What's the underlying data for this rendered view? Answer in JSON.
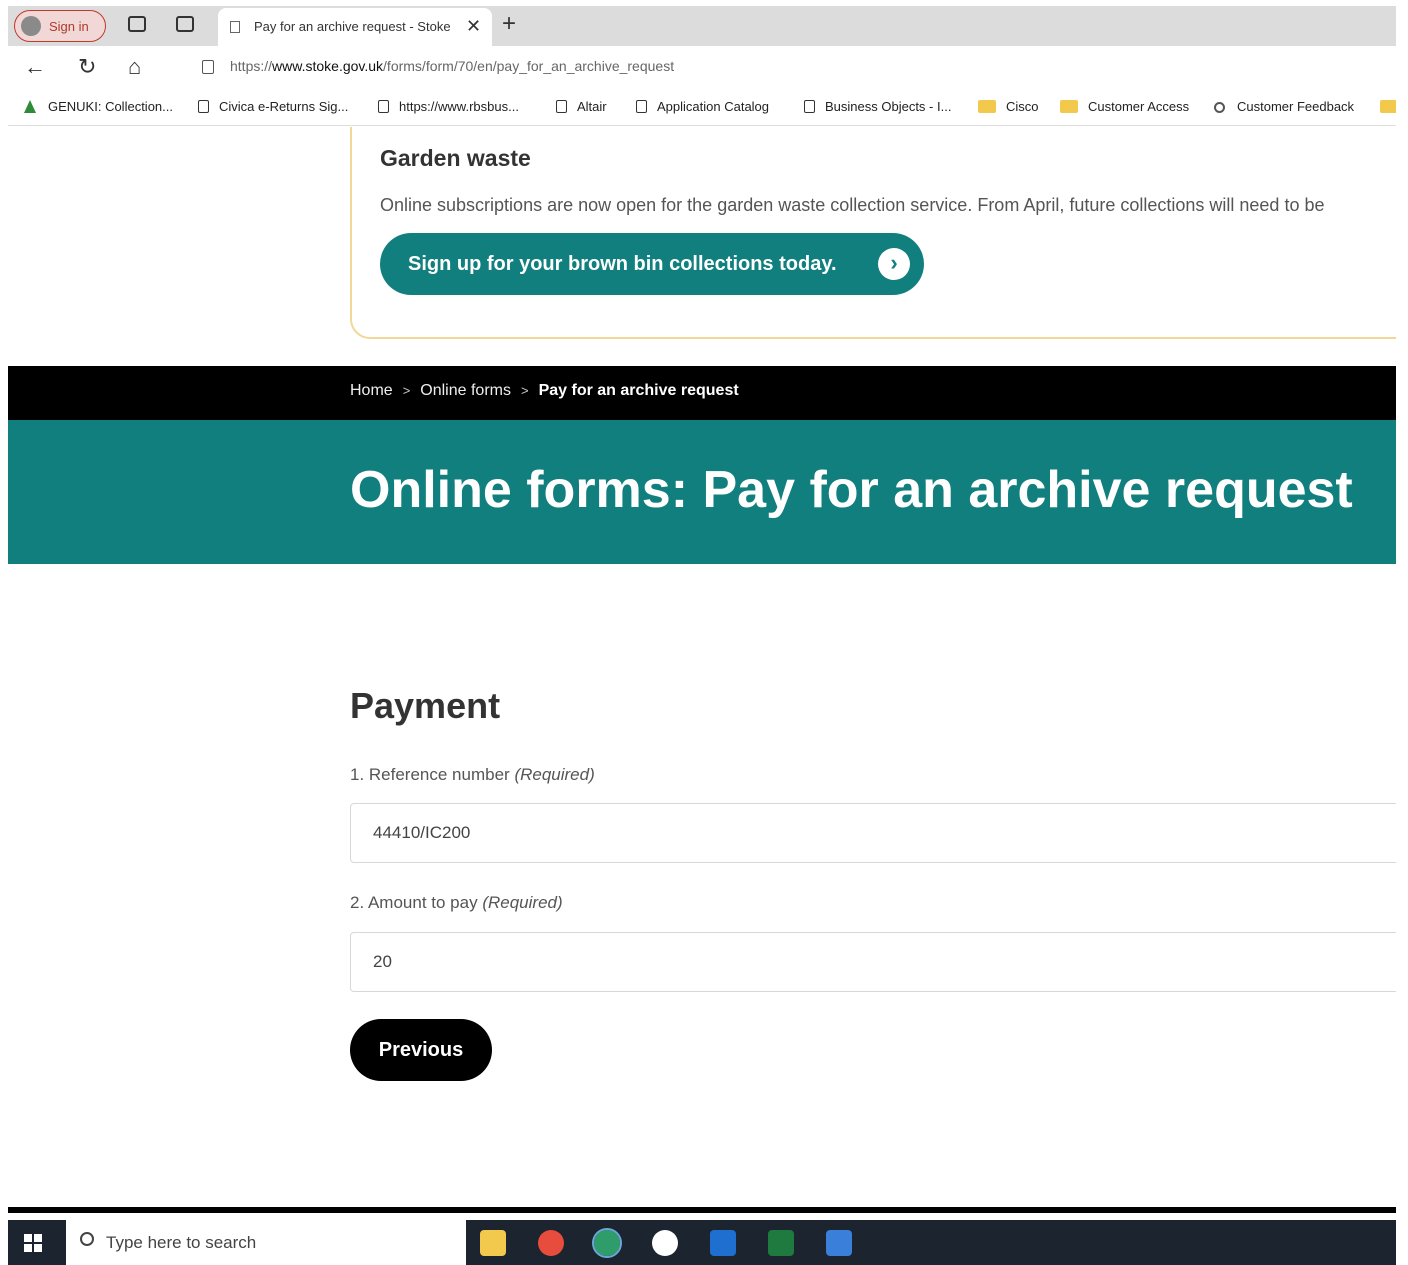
{
  "browser": {
    "sign_in_label": "Sign in",
    "tab_title": "Pay for an archive request - Stoke",
    "url_prefix": "https://",
    "url_domain": "www.stoke.gov.uk",
    "url_path": "/forms/form/70/en/pay_for_an_archive_request",
    "bookmarks": [
      {
        "label": "GENUKI: Collection...",
        "icon": "genuki-leaf-icon"
      },
      {
        "label": "Civica e-Returns Sig...",
        "icon": "page-icon"
      },
      {
        "label": "https://www.rbsbus...",
        "icon": "page-icon"
      },
      {
        "label": "Altair",
        "icon": "page-icon"
      },
      {
        "label": "Application Catalog",
        "icon": "page-icon"
      },
      {
        "label": "Business Objects - I...",
        "icon": "page-icon"
      },
      {
        "label": "Cisco",
        "icon": "folder-icon"
      },
      {
        "label": "Customer Access",
        "icon": "folder-icon"
      },
      {
        "label": "Customer Feedback",
        "icon": "gear-icon"
      }
    ]
  },
  "notice": {
    "title": "Garden waste",
    "text": "Online subscriptions are now open for the garden waste collection service. From April, future collections will need to be",
    "cta_label": "Sign up for your brown bin collections today."
  },
  "breadcrumb": {
    "home": "Home",
    "online_forms": "Online forms",
    "current": "Pay for an archive request"
  },
  "hero": {
    "title": "Online forms: Pay for an archive request"
  },
  "form": {
    "section_title": "Payment",
    "field1": {
      "label": "1. Reference number",
      "required": "(Required)",
      "value": "44410/IC200"
    },
    "field2": {
      "label": "2. Amount to pay",
      "required": "(Required)",
      "value": "20"
    },
    "previous_label": "Previous"
  },
  "taskbar": {
    "search_placeholder": "Type here to search",
    "apps": [
      "file-explorer-icon",
      "chrome-icon",
      "edge-icon",
      "chat-icon",
      "outlook-icon",
      "excel-icon",
      "photos-icon"
    ]
  },
  "colors": {
    "teal": "#127f7f",
    "notice_border": "#f2d896"
  }
}
